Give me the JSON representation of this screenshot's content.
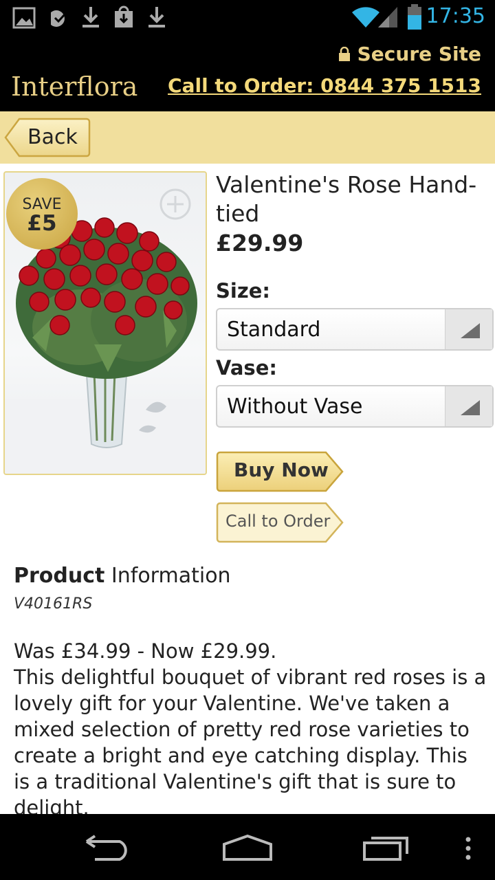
{
  "status_bar": {
    "time": "17:35",
    "left_icons": [
      "gallery-icon",
      "sync-icon",
      "download-icon",
      "store-download-icon",
      "download-icon"
    ],
    "right_icons": [
      "wifi-icon",
      "signal-icon",
      "battery-icon"
    ],
    "accent": "#33b5e5"
  },
  "header": {
    "secure_label": "Secure Site",
    "logo": "Interflora",
    "call_label": "Call to Order: 0844 375 1513",
    "gold": "#e8cf86"
  },
  "nav": {
    "back_label": "Back",
    "bar_color": "#f1df9d"
  },
  "product": {
    "save_badge": {
      "line1": "SAVE",
      "line2": "£5"
    },
    "title": "Valentine's Rose Hand-tied",
    "price": "£29.99",
    "size_label": "Size:",
    "size_value": "Standard",
    "vase_label": "Vase:",
    "vase_value": "Without Vase",
    "buy_label": "Buy Now",
    "call_label": "Call to Order"
  },
  "info": {
    "heading_bold": "Product",
    "heading_rest": "Information",
    "sku": "V40161RS",
    "price_line": "Was £34.99 - Now £29.99.",
    "description": "This delightful bouquet of vibrant red roses is a lovely gift for your Valentine. We've taken a mixed selection of pretty red rose varieties to create a bright and eye catching display. This is a traditional Valentine's gift that is sure to delight."
  },
  "system_nav": [
    "back-icon",
    "home-icon",
    "recents-icon",
    "menu-icon"
  ]
}
